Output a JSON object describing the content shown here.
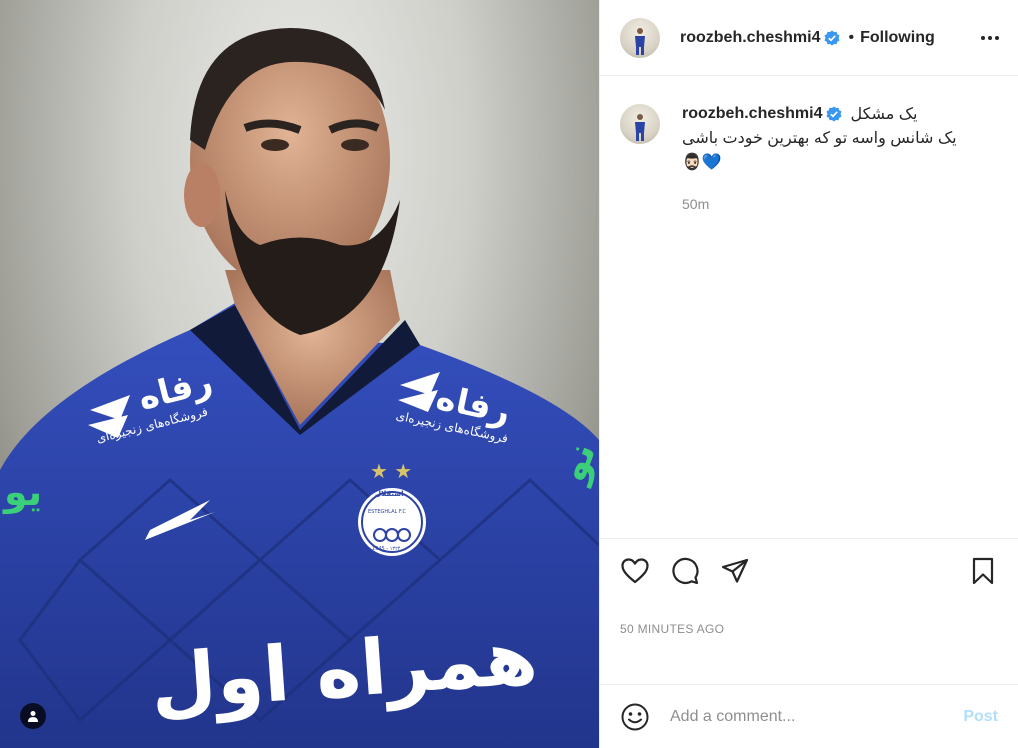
{
  "header": {
    "username": "roozbeh.cheshmi4",
    "separator": "•",
    "follow_label": "Following"
  },
  "caption": {
    "username": "roozbeh.cheshmi4",
    "line1": "یک مشکل",
    "line2": "یک شانس واسه تو که بهترین خودت باشی",
    "emojis": "🧔🏻‍♂️💙",
    "time": "50m"
  },
  "photo": {
    "sponsor_left": "رفاه",
    "sponsor_left_sub": "فروشگاه‌های زنجیره‌ای",
    "sponsor_right": "رفاه",
    "sponsor_right_sub": "فروشگاه‌های زنجیره‌ای",
    "main_sponsor": "همراه اول",
    "club_crest_top": "استقلال",
    "club_crest_name": "ESTEGHLAL F.C",
    "club_crest_years": "1945 - ۱۳۲۴",
    "sleeve_left": "یو",
    "sleeve_right": "نو"
  },
  "post": {
    "timestamp": "50 MINUTES AGO"
  },
  "comment": {
    "placeholder": "Add a comment...",
    "post_label": "Post"
  },
  "icons": {
    "verified": "verified-badge-icon",
    "more": "more-options-icon",
    "like": "heart-icon",
    "comment": "comment-bubble-icon",
    "share": "paper-plane-icon",
    "save": "bookmark-icon",
    "emoji": "smiley-icon",
    "tags": "user-tag-icon"
  },
  "colors": {
    "verified_blue": "#3897f0",
    "jersey_blue": "#2c43a6",
    "post_button": "#b2dffc"
  }
}
